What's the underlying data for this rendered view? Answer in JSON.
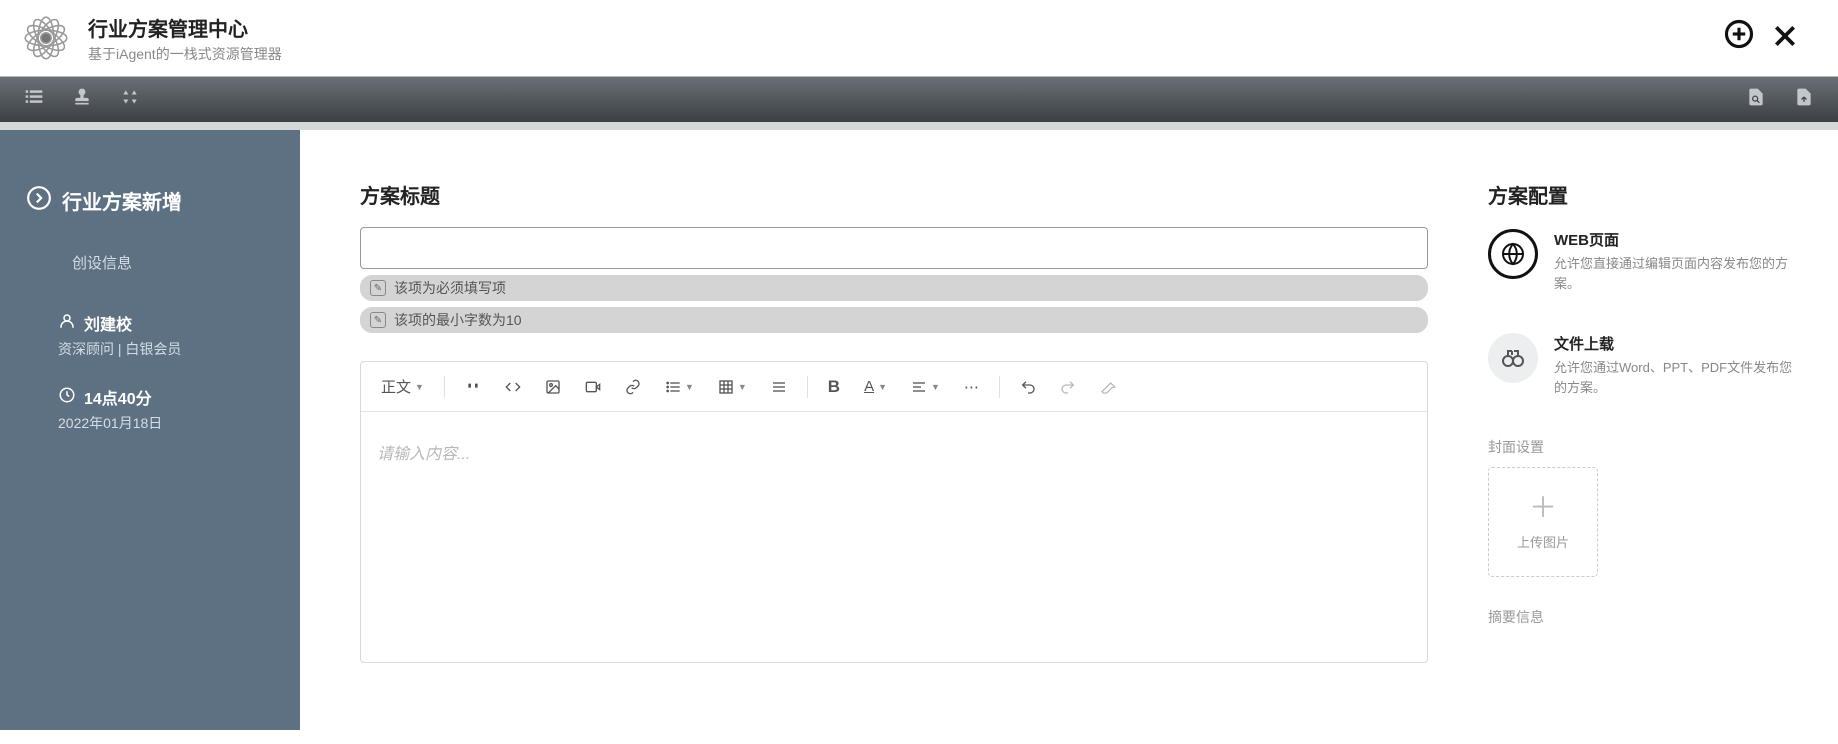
{
  "header": {
    "title": "行业方案管理中心",
    "subtitle": "基于iAgent的一栈式资源管理器"
  },
  "sidebar": {
    "title": "行业方案新增",
    "link_create": "创设信息",
    "user_name": "刘建校",
    "user_role": "资深顾问 | 白银会员",
    "time": "14点40分",
    "date": "2022年01月18日"
  },
  "form": {
    "title_label": "方案标题",
    "validation_required": "该项为必须填写项",
    "validation_minlen": "该项的最小字数为10",
    "editor_placeholder": "请输入内容...",
    "editor_style_label": "正文"
  },
  "config": {
    "section_title": "方案配置",
    "web_title": "WEB页面",
    "web_desc": "允许您直接通过编辑页面内容发布您的方案。",
    "file_title": "文件上载",
    "file_desc": "允许您通过Word、PPT、PDF文件发布您的方案。",
    "cover_label": "封面设置",
    "upload_text": "上传图片",
    "summary_label": "摘要信息"
  }
}
